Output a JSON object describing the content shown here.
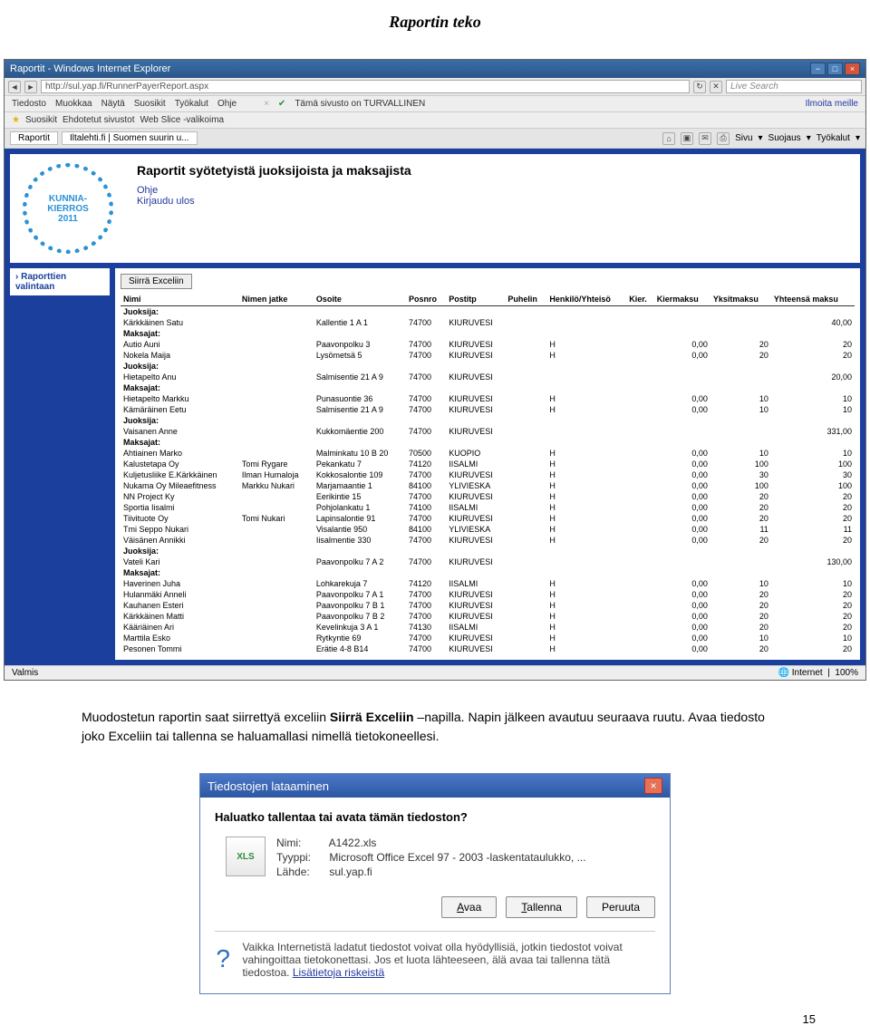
{
  "pageTitle": "Raportin teko",
  "ie": {
    "title": "Raportit - Windows Internet Explorer",
    "address": "http://sul.yap.fi/RunnerPayerReport.aspx",
    "menus": [
      "Tiedosto",
      "Muokkaa",
      "Näytä",
      "Suosikit",
      "Työkalut",
      "Ohje"
    ],
    "security": "Tämä sivusto on TURVALLINEN",
    "reportLink": "Ilmoita meille",
    "favLabel": "Suosikit",
    "favItems": [
      "Ehdotetut sivustot",
      "Web Slice -valikoima"
    ],
    "tabs": [
      "Raportit",
      "Iltalehti.fi | Suomen suurin u..."
    ],
    "toolsRight": [
      "Sivu",
      "Suojaus",
      "Työkalut"
    ],
    "searchPlaceholder": "Live Search",
    "status": "Valmis",
    "zone": "Internet",
    "zoom": "100%"
  },
  "app": {
    "logoLine1": "KUNNIA-",
    "logoLine2": "KIERROS",
    "logoYear": "2011",
    "heading": "Raportit syötetyistä juoksijoista ja maksajista",
    "helpLink": "Ohje",
    "logoutLink": "Kirjaudu ulos",
    "sidebarItem": "› Raporttien valintaan",
    "excelBtn": "Siirrä Exceliin",
    "columns": [
      "Nimi",
      "Nimen jatke",
      "Osoite",
      "Posnro",
      "Postitp",
      "Puhelin",
      "Henkilö/Yhteisö",
      "Kier.",
      "Kiermaksu",
      "Yksitmaksu",
      "Yhteensä maksu"
    ],
    "rows": [
      {
        "type": "section",
        "label": "Juoksija:"
      },
      {
        "type": "data",
        "c": [
          "Kärkkäinen Satu",
          "",
          "Kallentie 1 A 1",
          "74700",
          "KIURUVESI",
          "",
          "",
          "",
          "",
          "",
          "40,00"
        ]
      },
      {
        "type": "section",
        "label": "Maksajat:"
      },
      {
        "type": "data",
        "c": [
          "Autio Auni",
          "",
          "Paavonpolku 3",
          "74700",
          "KIURUVESI",
          "",
          "H",
          "",
          "0,00",
          "20",
          "20"
        ]
      },
      {
        "type": "data",
        "c": [
          "Nokela Maija",
          "",
          "Lysömetsä 5",
          "74700",
          "KIURUVESI",
          "",
          "H",
          "",
          "0,00",
          "20",
          "20"
        ]
      },
      {
        "type": "section",
        "label": "Juoksija:"
      },
      {
        "type": "data",
        "c": [
          "Hietapelto Anu",
          "",
          "Salmisentie 21 A 9",
          "74700",
          "KIURUVESI",
          "",
          "",
          "",
          "",
          "",
          "20,00"
        ]
      },
      {
        "type": "section",
        "label": "Maksajat:"
      },
      {
        "type": "data",
        "c": [
          "Hietapelto Markku",
          "",
          "Punasuontie 36",
          "74700",
          "KIURUVESI",
          "",
          "H",
          "",
          "0,00",
          "10",
          "10"
        ]
      },
      {
        "type": "data",
        "c": [
          "Kämäräinen Eetu",
          "",
          "Salmisentie 21 A 9",
          "74700",
          "KIURUVESI",
          "",
          "H",
          "",
          "0,00",
          "10",
          "10"
        ]
      },
      {
        "type": "section",
        "label": "Juoksija:"
      },
      {
        "type": "data",
        "c": [
          "Vaisanen Anne",
          "",
          "Kukkomäentie 200",
          "74700",
          "KIURUVESI",
          "",
          "",
          "",
          "",
          "",
          "331,00"
        ]
      },
      {
        "type": "section",
        "label": "Maksajat:"
      },
      {
        "type": "data",
        "c": [
          "Ahtiainen Marko",
          "",
          "Malminkatu 10 B 20",
          "70500",
          "KUOPIO",
          "",
          "H",
          "",
          "0,00",
          "10",
          "10"
        ]
      },
      {
        "type": "data",
        "c": [
          "Kalustetapa Oy",
          "Tomi Rygare",
          "Pekankatu 7",
          "74120",
          "IISALMI",
          "",
          "H",
          "",
          "0,00",
          "100",
          "100"
        ]
      },
      {
        "type": "data",
        "c": [
          "Kuljetusliike E.Kärkkäinen",
          "Ilman Humaloja",
          "Kokkosalontie 109",
          "74700",
          "KIURUVESI",
          "",
          "H",
          "",
          "0,00",
          "30",
          "30"
        ]
      },
      {
        "type": "data",
        "c": [
          "Nukama Oy Mileaefitness",
          "Markku Nukari",
          "Marjamaantie 1",
          "84100",
          "YLIVIESKA",
          "",
          "H",
          "",
          "0,00",
          "100",
          "100"
        ]
      },
      {
        "type": "data",
        "c": [
          "NN Project Ky",
          "",
          "Eerikintie 15",
          "74700",
          "KIURUVESI",
          "",
          "H",
          "",
          "0,00",
          "20",
          "20"
        ]
      },
      {
        "type": "data",
        "c": [
          "Sportia Iisalmi",
          "",
          "Pohjolankatu 1",
          "74100",
          "IISALMI",
          "",
          "H",
          "",
          "0,00",
          "20",
          "20"
        ]
      },
      {
        "type": "data",
        "c": [
          "Tiivituote Oy",
          "Tomi Nukari",
          "Lapinsalontie 91",
          "74700",
          "KIURUVESI",
          "",
          "H",
          "",
          "0,00",
          "20",
          "20"
        ]
      },
      {
        "type": "data",
        "c": [
          "Tmi Seppo Nukari",
          "",
          "Visalantie 950",
          "84100",
          "YLIVIESKA",
          "",
          "H",
          "",
          "0,00",
          "11",
          "11"
        ]
      },
      {
        "type": "data",
        "c": [
          "Väisänen Annikki",
          "",
          "Iisalmentie 330",
          "74700",
          "KIURUVESI",
          "",
          "H",
          "",
          "0,00",
          "20",
          "20"
        ]
      },
      {
        "type": "section",
        "label": "Juoksija:"
      },
      {
        "type": "data",
        "c": [
          "Vateli Kari",
          "",
          "Paavonpolku 7 A 2",
          "74700",
          "KIURUVESI",
          "",
          "",
          "",
          "",
          "",
          "130,00"
        ]
      },
      {
        "type": "section",
        "label": "Maksajat:"
      },
      {
        "type": "data",
        "c": [
          "Haverinen Juha",
          "",
          "Lohkarekuja 7",
          "74120",
          "IISALMI",
          "",
          "H",
          "",
          "0,00",
          "10",
          "10"
        ]
      },
      {
        "type": "data",
        "c": [
          "Hulanmäki Anneli",
          "",
          "Paavonpolku 7 A 1",
          "74700",
          "KIURUVESI",
          "",
          "H",
          "",
          "0,00",
          "20",
          "20"
        ]
      },
      {
        "type": "data",
        "c": [
          "Kauhanen Esteri",
          "",
          "Paavonpolku 7 B 1",
          "74700",
          "KIURUVESI",
          "",
          "H",
          "",
          "0,00",
          "20",
          "20"
        ]
      },
      {
        "type": "data",
        "c": [
          "Kärkkäinen Matti",
          "",
          "Paavonpolku 7 B 2",
          "74700",
          "KIURUVESI",
          "",
          "H",
          "",
          "0,00",
          "20",
          "20"
        ]
      },
      {
        "type": "data",
        "c": [
          "Kääriäinen Ari",
          "",
          "Kevelinkuja 3 A 1",
          "74130",
          "IISALMI",
          "",
          "H",
          "",
          "0,00",
          "20",
          "20"
        ]
      },
      {
        "type": "data",
        "c": [
          "Marttila Esko",
          "",
          "Rytkyntie 69",
          "74700",
          "KIURUVESI",
          "",
          "H",
          "",
          "0,00",
          "10",
          "10"
        ]
      },
      {
        "type": "data",
        "c": [
          "Pesonen Tommi",
          "",
          "Erätie 4-8 B14",
          "74700",
          "KIURUVESI",
          "",
          "H",
          "",
          "0,00",
          "20",
          "20"
        ]
      }
    ]
  },
  "bodyText": {
    "p1a": "Muodostetun raportin saat siirrettyä exceliin ",
    "p1b": "Siirrä Exceliin",
    "p1c": " –napilla. Napin jälkeen avautuu seuraava ruutu. Avaa tiedosto joko Exceliin tai tallenna se haluamallasi nimellä tietokoneellesi."
  },
  "dialog": {
    "title": "Tiedostojen lataaminen",
    "question": "Haluatko tallentaa tai avata tämän tiedoston?",
    "nameLabel": "Nimi:",
    "nameValue": "A1422.xls",
    "typeLabel": "Tyyppi:",
    "typeValue": "Microsoft Office Excel 97 - 2003 -laskentataulukko, ...",
    "sourceLabel": "Lähde:",
    "sourceValue": "sul.yap.fi",
    "btnOpen": "Avaa",
    "btnSave": "Tallenna",
    "btnCancel": "Peruuta",
    "warning": "Vaikka Internetistä ladatut tiedostot voivat olla hyödyllisiä, jotkin tiedostot voivat vahingoittaa tietokonettasi. Jos et luota lähteeseen, älä avaa tai tallenna tätä tiedostoa. ",
    "riskLink": "Lisätietoja riskeistä"
  },
  "pageNum": "15"
}
